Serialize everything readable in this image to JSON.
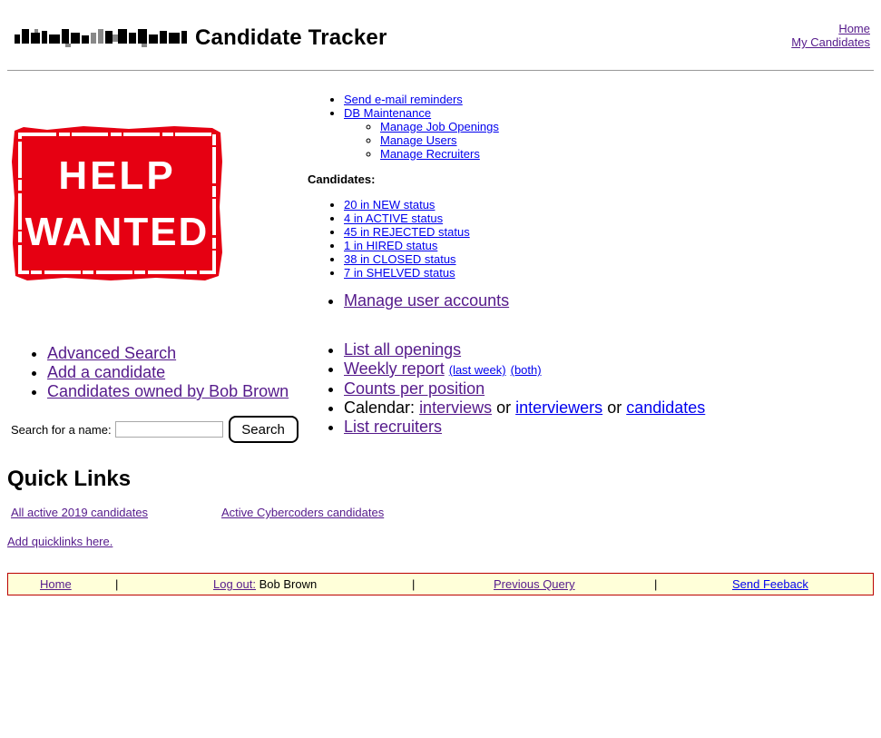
{
  "header": {
    "title": "Candidate Tracker",
    "logo": {
      "name": "redacted-logo",
      "visible_text": ""
    },
    "top_links": [
      "Home",
      "My Candidates"
    ]
  },
  "poster": {
    "line1": "HELP",
    "line2": "WANTED",
    "colors": {
      "stamp_red": "#e60012",
      "ink_white": "#ffffff"
    }
  },
  "admin": {
    "items": [
      "Send e-mail reminders",
      "DB Maintenance"
    ],
    "db_sub": [
      "Manage Job Openings",
      "Manage Users",
      "Manage Recruiters"
    ]
  },
  "candidates": {
    "heading": "Candidates:",
    "status_links": [
      "20 in NEW status",
      "4 in ACTIVE status",
      "45 in REJECTED status",
      "1 in HIRED status",
      "38 in CLOSED status",
      "7 in SHELVED status"
    ]
  },
  "manage_user_accounts": "Manage user accounts",
  "left_links": [
    "Advanced Search",
    "Add a candidate",
    "Candidates owned by Bob Brown"
  ],
  "right_links": {
    "list_openings": "List all openings",
    "weekly_report": "Weekly report",
    "last_week": "(last week)",
    "both": "(both)",
    "counts": "Counts per position",
    "calendar_label": "Calendar:",
    "interviews": "interviews",
    "or": "or",
    "interviewers": "interviewers",
    "candidates": "candidates",
    "list_recruiters": "List recruiters"
  },
  "search": {
    "label": "Search for a name:",
    "value": "",
    "placeholder": "",
    "button": "Search"
  },
  "quick_links": {
    "title": "Quick Links",
    "links": [
      "All active 2019 candidates",
      "Active Cybercoders candidates"
    ],
    "add": "Add quicklinks here."
  },
  "footer": {
    "home": "Home",
    "logout": "Log out:",
    "user": "Bob Brown",
    "previous_query": "Previous Query",
    "feedback": "Send Feeback",
    "separator": "|"
  },
  "colors": {
    "link": "#1a0dab",
    "visited": "#551a8b",
    "footer_bg": "#ffffd9",
    "footer_border": "#bb0000",
    "rule": "#999999"
  }
}
